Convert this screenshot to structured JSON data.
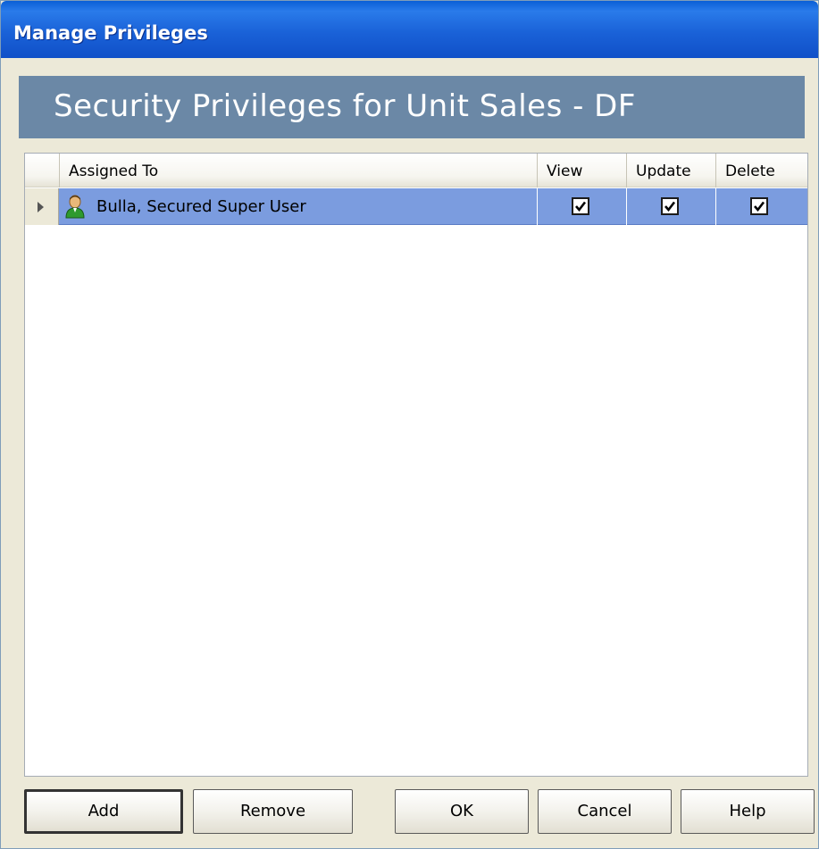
{
  "window": {
    "title": "Manage Privileges"
  },
  "banner": {
    "title": "Security Privileges for Unit Sales - DF"
  },
  "grid": {
    "columns": {
      "assigned_to": "Assigned To",
      "view": "View",
      "update": "Update",
      "delete": "Delete"
    },
    "rows": [
      {
        "icon": "user-icon",
        "assigned_to": "Bulla, Secured Super User",
        "view": true,
        "update": true,
        "delete": true
      }
    ]
  },
  "buttons": {
    "add": "Add",
    "remove": "Remove",
    "ok": "OK",
    "cancel": "Cancel",
    "help": "Help"
  },
  "colors": {
    "titlebar": "#1a62d8",
    "banner": "#6b88a6",
    "selected_row": "#7b9cdf",
    "window_bg": "#ece9d8"
  }
}
